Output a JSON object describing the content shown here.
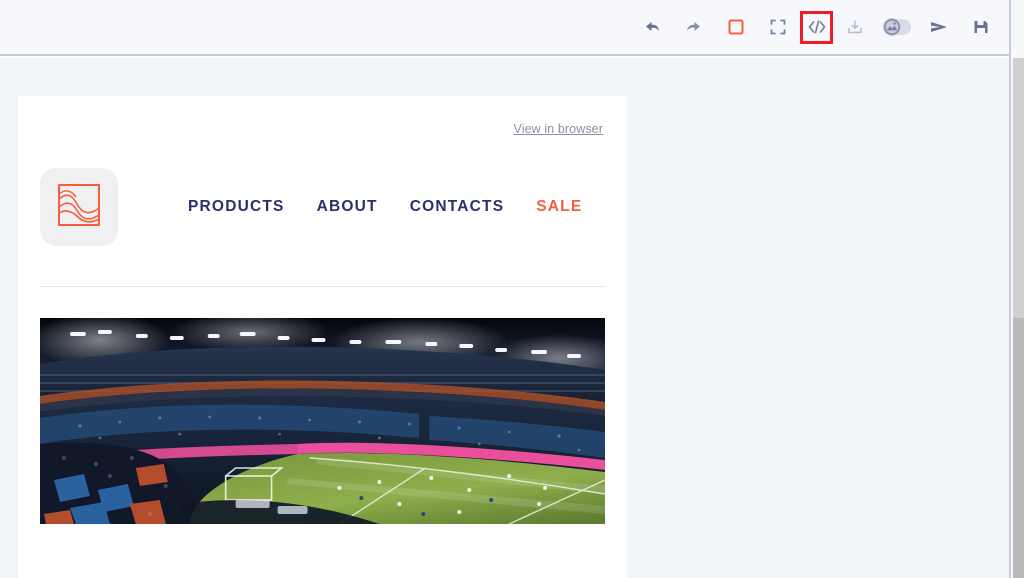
{
  "toolbar": {
    "buttons": [
      {
        "name": "undo",
        "label": "Undo",
        "icon": "undo-arrow-icon"
      },
      {
        "name": "redo",
        "label": "Redo",
        "icon": "redo-arrow-icon"
      },
      {
        "name": "stop",
        "label": "Stop",
        "icon": "square-outline-icon"
      },
      {
        "name": "fullscreen",
        "label": "Fullscreen preview",
        "icon": "expand-icon"
      },
      {
        "name": "code",
        "label": "View HTML code",
        "icon": "code-brackets-icon"
      },
      {
        "name": "import",
        "label": "Import",
        "icon": "download-tray-icon"
      },
      {
        "name": "images-toggle",
        "label": "Toggle images",
        "icon": "image-toggle-icon"
      },
      {
        "name": "send-test",
        "label": "Send",
        "icon": "paper-plane-icon"
      },
      {
        "name": "save",
        "label": "Save",
        "icon": "floppy-disk-icon"
      }
    ],
    "highlighted_button": "code"
  },
  "email": {
    "view_in_browser": "View in browser",
    "logo": {
      "icon": "image-placeholder-icon",
      "alt": "Logo"
    },
    "nav": [
      {
        "label": "PRODUCTS",
        "accent": false
      },
      {
        "label": "ABOUT",
        "accent": false
      },
      {
        "label": "CONTACTS",
        "accent": false
      },
      {
        "label": "SALE",
        "accent": true
      }
    ],
    "hero": {
      "alt": "Night football stadium with floodlights, crowded stands and green pitch",
      "icon": "stadium-photo"
    }
  },
  "colors": {
    "accent_orange": "#f4603e",
    "nav_navy": "#2b2f6e",
    "highlight_red": "#ee1c25",
    "toolbar_bg": "#f7f8fc",
    "workspace_bg": "#f1f4f9",
    "link_gray": "#8a8fa0"
  }
}
